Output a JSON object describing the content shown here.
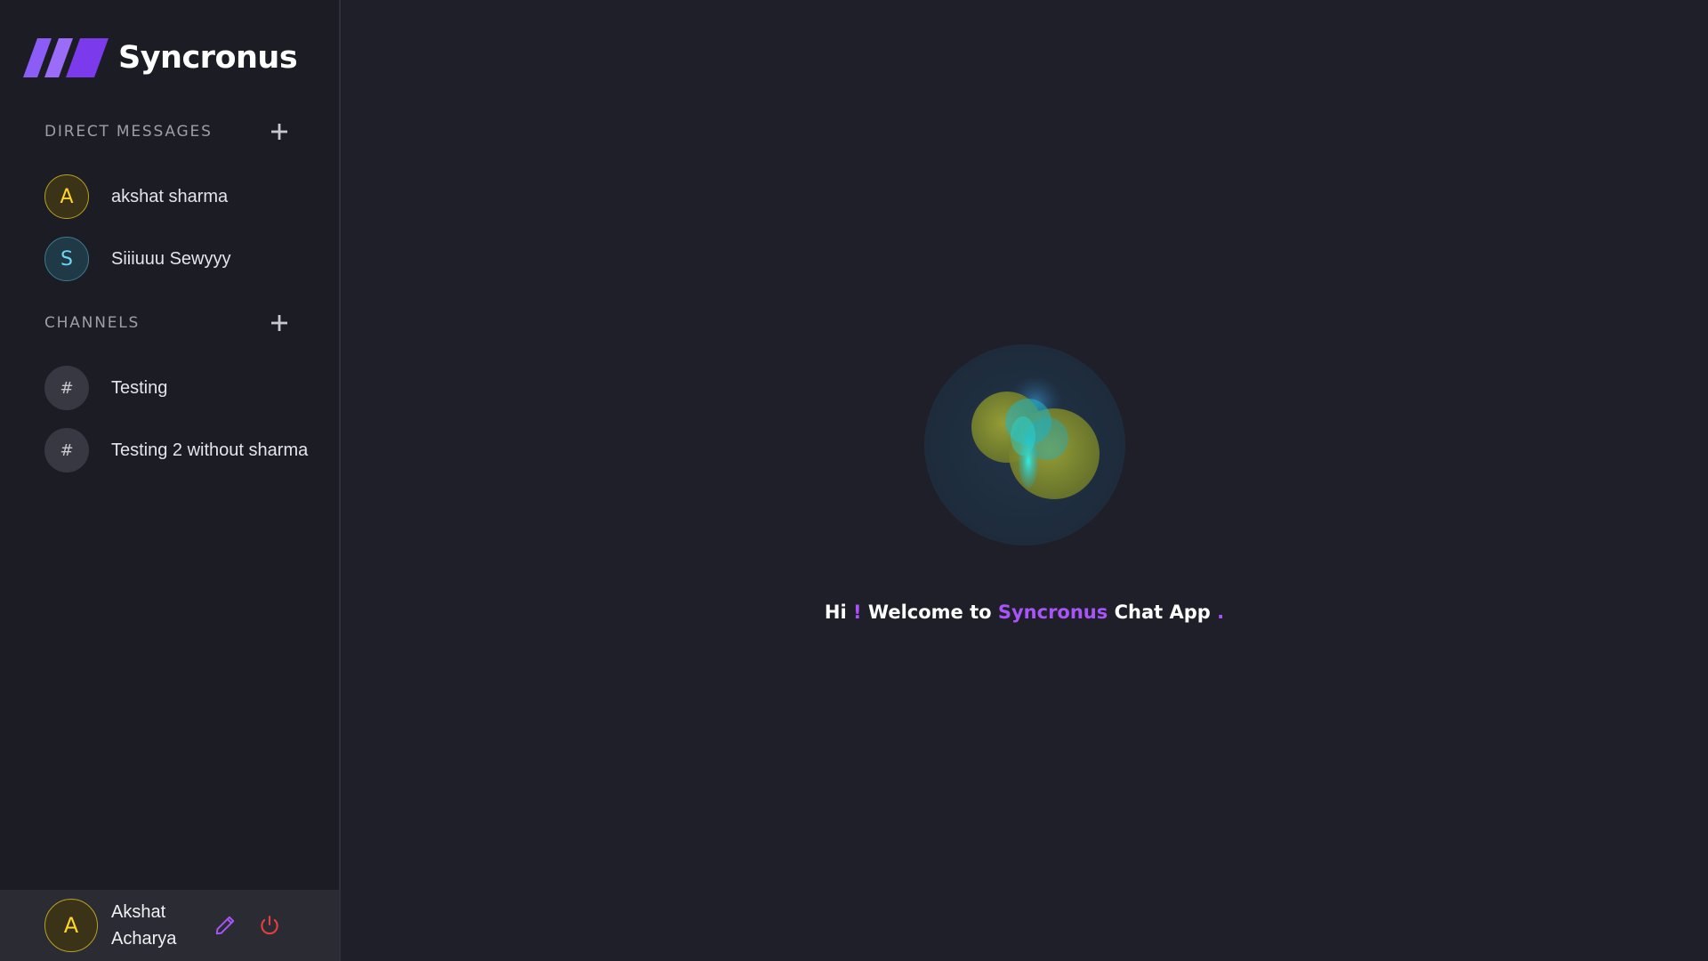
{
  "app": {
    "name": "Syncronus"
  },
  "sidebar": {
    "direct_messages": {
      "title": "DIRECT MESSAGES",
      "items": [
        {
          "initial": "A",
          "label": "akshat sharma",
          "color": "#ffd52b"
        },
        {
          "initial": "S",
          "label": "Siiiuuu Sewyyy",
          "color": "#6fd5f3"
        }
      ]
    },
    "channels": {
      "title": "CHANNELS",
      "items": [
        {
          "icon": "#",
          "label": "Testing"
        },
        {
          "icon": "#",
          "label": "Testing 2 without sharma"
        }
      ]
    },
    "profile": {
      "initial": "A",
      "first_name": "Akshat",
      "last_name": "Acharya",
      "edit_icon": "pencil-icon",
      "logout_icon": "power-icon"
    }
  },
  "main": {
    "welcome": {
      "hi": "Hi",
      "exclaim": "!",
      "welcome_to": "Welcome to",
      "app_name": "Syncronus",
      "suffix": "Chat App",
      "period": "."
    }
  },
  "colors": {
    "accent": "#a855f7",
    "danger": "#e53e3e",
    "background": "#1f1f29",
    "sidebar": "#1c1c25"
  }
}
